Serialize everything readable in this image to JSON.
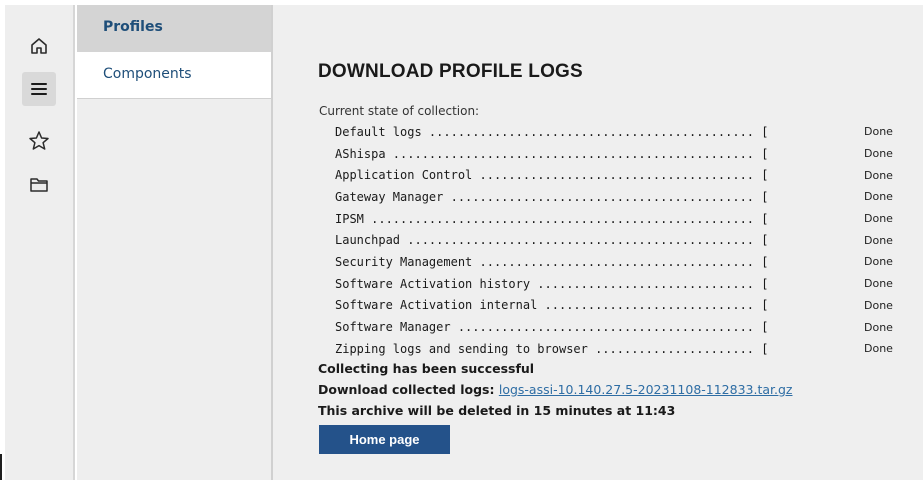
{
  "rail": {
    "icons": [
      "home-icon",
      "menu-icon",
      "star-icon",
      "folder-icon"
    ],
    "active_index": 1
  },
  "subnav": {
    "items": [
      {
        "label": "Profiles",
        "active": true
      },
      {
        "label": "Components",
        "active": false
      }
    ]
  },
  "main": {
    "title": "DOWNLOAD PROFILE LOGS",
    "state_label": "Current state of collection:",
    "logs": [
      {
        "line": "Default logs ............................................. [",
        "status": "Done"
      },
      {
        "line": "AShispa .................................................. [",
        "status": "Done"
      },
      {
        "line": "Application Control ...................................... [",
        "status": "Done"
      },
      {
        "line": "Gateway Manager .......................................... [",
        "status": "Done"
      },
      {
        "line": "IPSM ..................................................... [",
        "status": "Done"
      },
      {
        "line": "Launchpad ................................................ [",
        "status": "Done"
      },
      {
        "line": "Security Management ...................................... [",
        "status": "Done"
      },
      {
        "line": "Software Activation history .............................. [",
        "status": "Done"
      },
      {
        "line": "Software Activation internal ............................. [",
        "status": "Done"
      },
      {
        "line": "Software Manager ......................................... [",
        "status": "Done"
      },
      {
        "line": "Zipping logs and sending to browser ...................... [",
        "status": "Done"
      }
    ],
    "success_text": "Collecting has been successful",
    "download_label": "Download collected logs:",
    "download_link": "logs-assi-10.140.27.5-20231108-112833.tar.gz",
    "delete_notice": "This archive will be deleted in 15 minutes at 11:43",
    "home_button": "Home page"
  },
  "colors": {
    "accent": "#24528a",
    "link": "#2e6da4",
    "nav_text": "#1e4e79",
    "panel_bg": "#efefef"
  }
}
